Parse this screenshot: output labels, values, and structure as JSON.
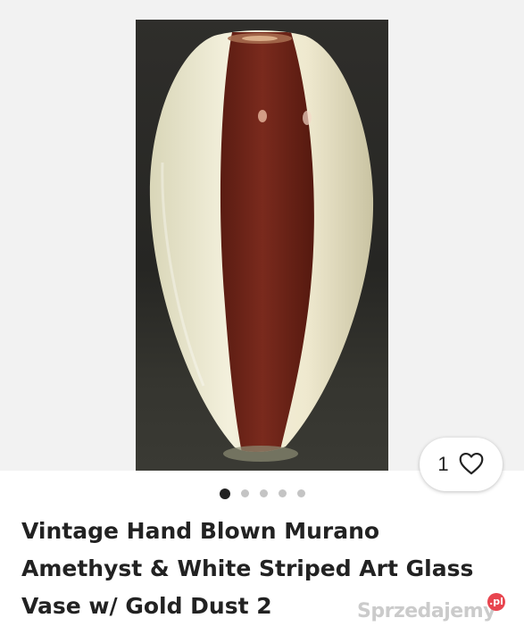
{
  "listing": {
    "title": "Vintage Hand Blown Murano Amethyst & White Striped Art Glass Vase w/ Gold Dust 2",
    "favorite_count": "1"
  },
  "gallery": {
    "total_images": 5,
    "active_index": 0
  },
  "icons": {
    "favorite": "heart-outline-icon"
  },
  "watermark": {
    "text": "Sprzedajemy",
    "badge": ".pl"
  }
}
